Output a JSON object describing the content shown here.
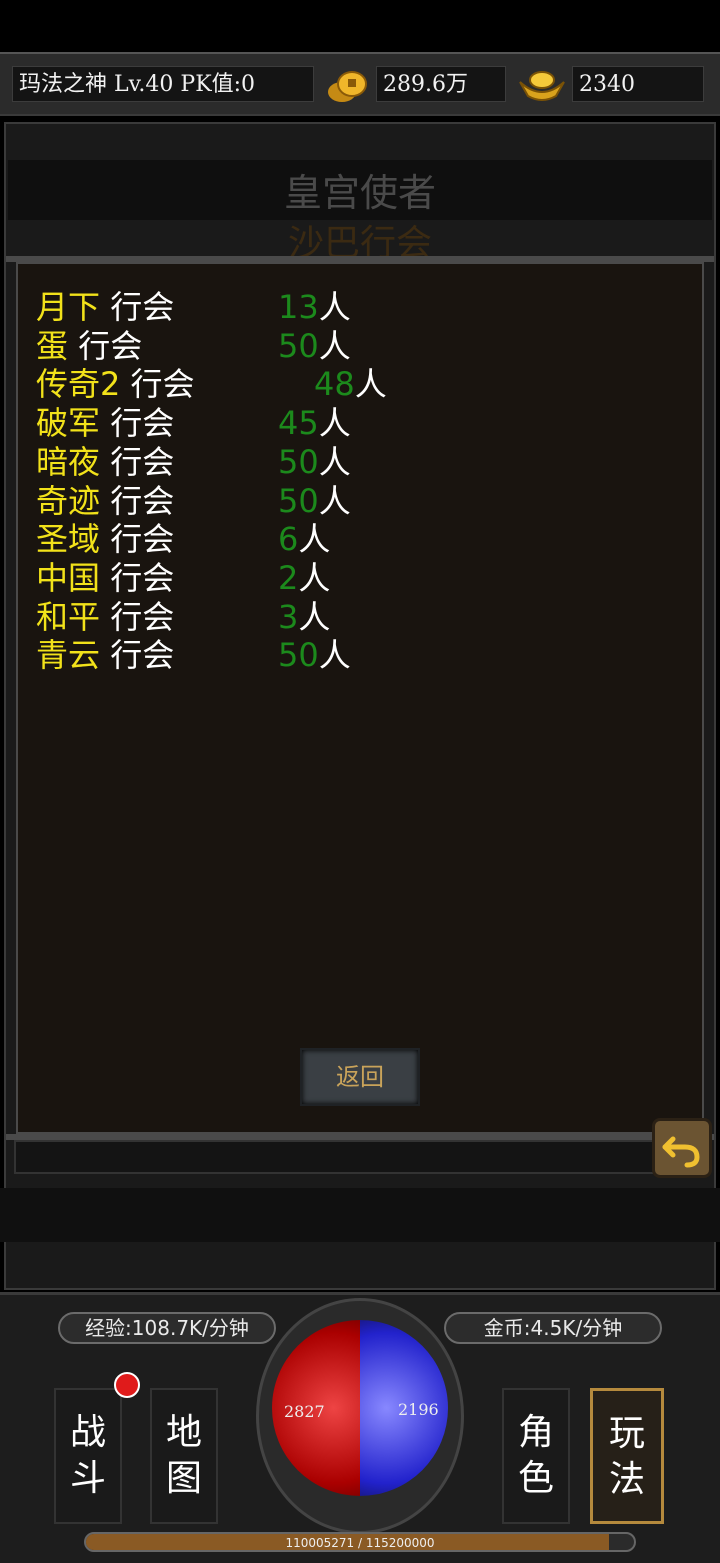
{
  "status": {
    "player_info": "玛法之神  Lv.40 PK值:0",
    "gold": "289.6万",
    "ingots": "2340"
  },
  "panel": {
    "npc_title": "皇宫使者",
    "sub_title": "沙巴行会",
    "guilds": [
      {
        "name": "月下",
        "suffix": " 行会",
        "count": "13",
        "unit": "人"
      },
      {
        "name": "蛋",
        "suffix": " 行会",
        "count": "50",
        "unit": "人"
      },
      {
        "name": "传奇2",
        "suffix": " 行会",
        "count": "48",
        "unit": "人"
      },
      {
        "name": "破军",
        "suffix": " 行会",
        "count": "45",
        "unit": "人"
      },
      {
        "name": "暗夜",
        "suffix": " 行会",
        "count": "50",
        "unit": "人"
      },
      {
        "name": "奇迹",
        "suffix": " 行会",
        "count": "50",
        "unit": "人"
      },
      {
        "name": "圣域",
        "suffix": " 行会",
        "count": "6",
        "unit": "人"
      },
      {
        "name": "中国",
        "suffix": " 行会",
        "count": "2",
        "unit": "人"
      },
      {
        "name": "和平",
        "suffix": " 行会",
        "count": "3",
        "unit": "人"
      },
      {
        "name": "青云",
        "suffix": " 行会",
        "count": "50",
        "unit": "人"
      }
    ],
    "return_label": "返回"
  },
  "hud": {
    "exp_rate": "经验:108.7K/分钟",
    "gold_rate": "金币:4.5K/分钟",
    "hp": "2827",
    "mp": "2196",
    "exp_progress": "110005271 / 115200000",
    "exp_fraction": 0.955,
    "buttons": {
      "battle": "战\n斗",
      "map": "地\n图",
      "character": "角\n色",
      "gameplay": "玩\n法"
    }
  },
  "colors": {
    "guild_name": "#f2e21a",
    "member_count": "#1c8a1c",
    "notification_badge": "#e01b1b",
    "hp_orb": "#cc2222",
    "mp_orb": "#2233cc"
  }
}
